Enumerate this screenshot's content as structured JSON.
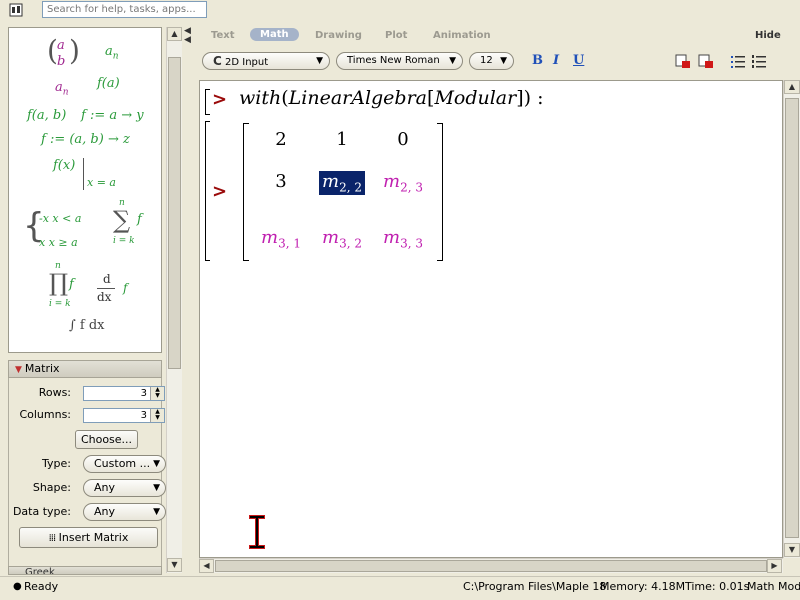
{
  "search": {
    "placeholder": "Search for help, tasks, apps..."
  },
  "palette": {
    "items": [
      {
        "name": "vector-template",
        "top": "a",
        "bottom": "b"
      },
      {
        "name": "subscript-template",
        "base": "a",
        "sub": "n"
      },
      {
        "name": "subscript-template-2",
        "base": "a",
        "sub": "n"
      },
      {
        "name": "function-template",
        "text": "f(a)"
      },
      {
        "name": "function-two-args-template",
        "text": "f(a, b)"
      },
      {
        "name": "arrow-template",
        "text": "f := a → y"
      },
      {
        "name": "assign-arrow-template",
        "text": "f := (a, b) → z"
      },
      {
        "name": "eval-at-template",
        "text": "f(x)",
        "cond": "x = a"
      },
      {
        "name": "piecewise-template",
        "row1": "-x   x < a",
        "row2": "x   x ≥ a"
      },
      {
        "name": "sum-template",
        "sym": "∑",
        "upper": "n",
        "lower": "i = k",
        "term": "f"
      },
      {
        "name": "product-template",
        "sym": "∏",
        "upper": "n",
        "lower": "i = k",
        "term": "f"
      },
      {
        "name": "derivative-template",
        "num": "d",
        "den": "dx",
        "term": "f"
      },
      {
        "name": "integral-template",
        "text": "∫ f dx"
      }
    ]
  },
  "matrix_panel": {
    "title": "Matrix",
    "rows_label": "Rows:",
    "rows_value": "3",
    "columns_label": "Columns:",
    "columns_value": "3",
    "choose_button": "Choose...",
    "type_label": "Type:",
    "type_value": "Custom ...",
    "shape_label": "Shape:",
    "shape_value": "Any",
    "datatype_label": "Data type:",
    "datatype_value": "Any",
    "insert_button": "Insert Matrix",
    "next_panel": "Greek"
  },
  "toolbar": {
    "modes": [
      "Text",
      "Math",
      "Drawing",
      "Plot",
      "Animation"
    ],
    "active_mode": "Math",
    "hide": "Hide",
    "input_mode": "2D Input",
    "input_mode_prefix": "C",
    "font": "Times New Roman",
    "size": "12",
    "bold": "B",
    "italic": "I",
    "underline": "U"
  },
  "worksheet": {
    "prompt": ">",
    "input": {
      "fn": "with",
      "lp": "(",
      "pkg": "LinearAlgebra",
      "lb": "[",
      "sub": "Modular",
      "rb": "]",
      "rp": ")",
      "term": " :"
    },
    "matrix": [
      [
        {
          "t": "2",
          "sym": false
        },
        {
          "t": "1",
          "sym": false
        },
        {
          "t": "0",
          "sym": false
        }
      ],
      [
        {
          "t": "3",
          "sym": false
        },
        {
          "b": "m",
          "s": "2, 2",
          "sym": true,
          "sel": true
        },
        {
          "b": "m",
          "s": "2, 3",
          "sym": true
        }
      ],
      [
        {
          "b": "m",
          "s": "3, 1",
          "sym": true
        },
        {
          "b": "m",
          "s": "3, 2",
          "sym": true
        },
        {
          "b": "m",
          "s": "3, 3",
          "sym": true
        }
      ]
    ]
  },
  "status": {
    "ready": "Ready",
    "path": "C:\\Program Files\\Maple 18",
    "memory": "Memory: 4.18M",
    "time": "Time: 0.01s",
    "mode": "Math Mode"
  },
  "colors": {
    "prompt": "#9a0a0a",
    "symbol": "#c020b0",
    "selection": "#0a246a",
    "palette_green": "#2a9a3a"
  }
}
